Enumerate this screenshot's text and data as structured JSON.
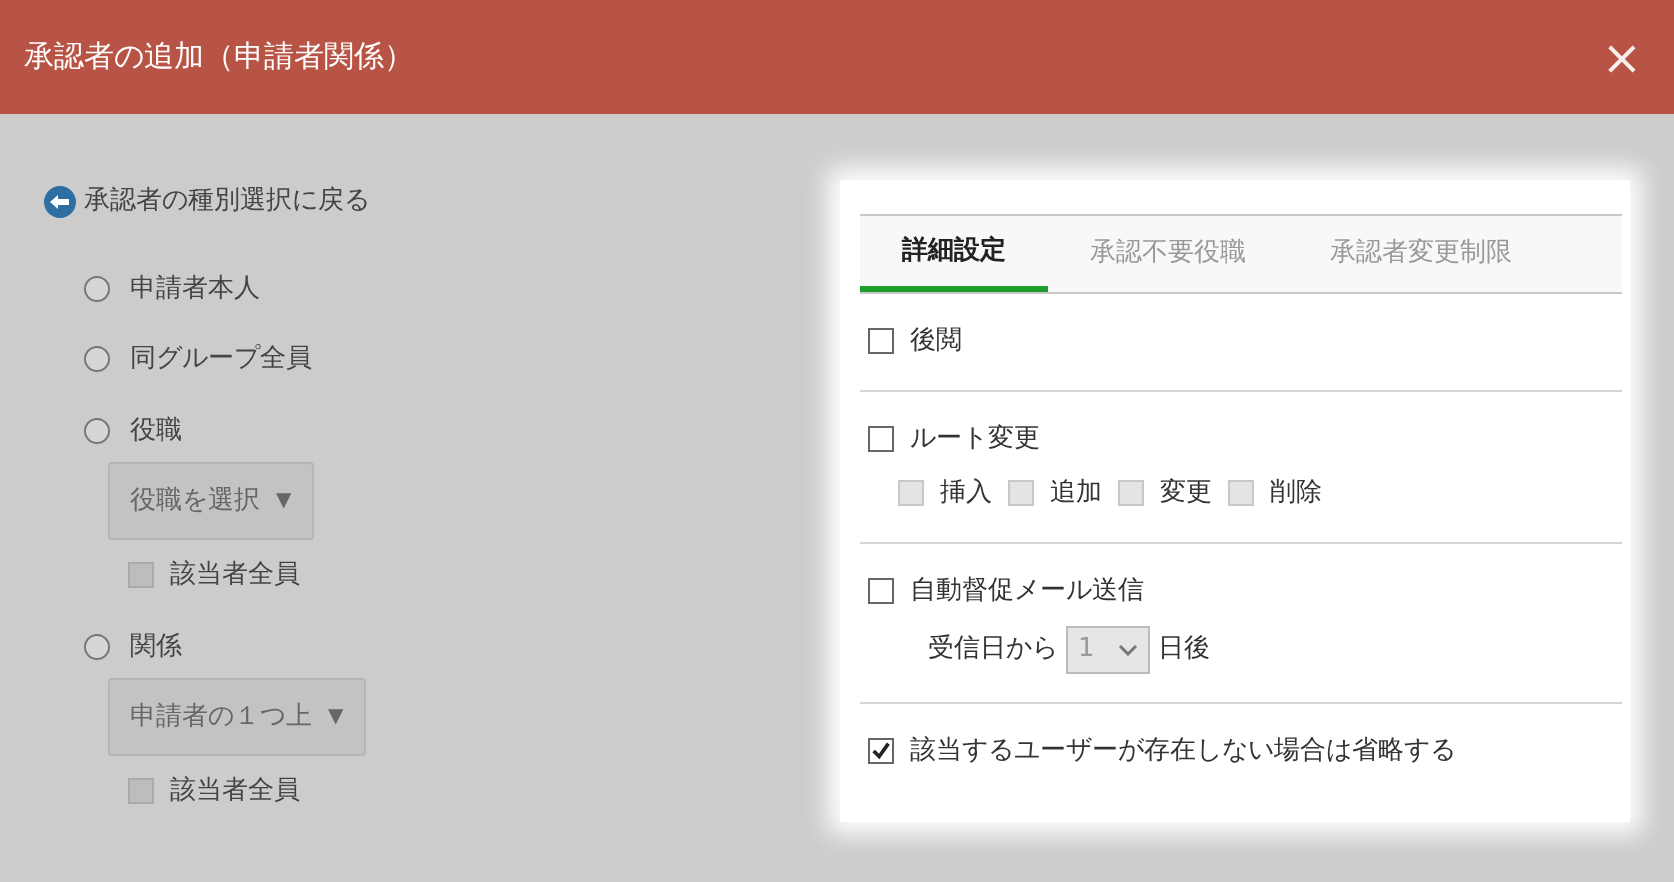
{
  "window": {
    "title": "承認者の追加（申請者関係）",
    "close": "×"
  },
  "back_link": "承認者の種別選択に戻る",
  "options": [
    {
      "label": "申請者本人",
      "selected": false
    },
    {
      "label": "同グループ全員",
      "selected": false
    },
    {
      "label": "役職",
      "selected": false,
      "select": {
        "value": "役職を選択",
        "arrow": "▼"
      },
      "all": {
        "label": "該当者全員",
        "checked": false
      }
    },
    {
      "label": "関係",
      "selected": false,
      "select": {
        "value": "申請者の１つ上",
        "arrow": "▼"
      },
      "all": {
        "label": "該当者全員",
        "checked": false
      }
    }
  ],
  "tabs": [
    {
      "label": "詳細設定",
      "selected": true
    },
    {
      "label": "承認不要役職",
      "selected": false
    },
    {
      "label": "承認者変更制限",
      "selected": false
    }
  ],
  "settings": [
    {
      "kind": "check",
      "label": "後閲",
      "checked": false
    },
    {
      "kind": "route",
      "label": "ルート変更",
      "checked": false,
      "sub": [
        {
          "label": "挿入",
          "checked": false,
          "disabled": true
        },
        {
          "label": "追加",
          "checked": false,
          "disabled": true
        },
        {
          "label": "変更",
          "checked": false,
          "disabled": true
        },
        {
          "label": "削除",
          "checked": false,
          "disabled": true
        }
      ]
    },
    {
      "kind": "mail",
      "label": "自動督促メール送信",
      "checked": false,
      "before": "受信日から",
      "value": "1",
      "after": "日後",
      "disabled": true
    },
    {
      "kind": "check",
      "label": "該当するユーザーが存在しない場合は省略する",
      "checked": true
    }
  ]
}
